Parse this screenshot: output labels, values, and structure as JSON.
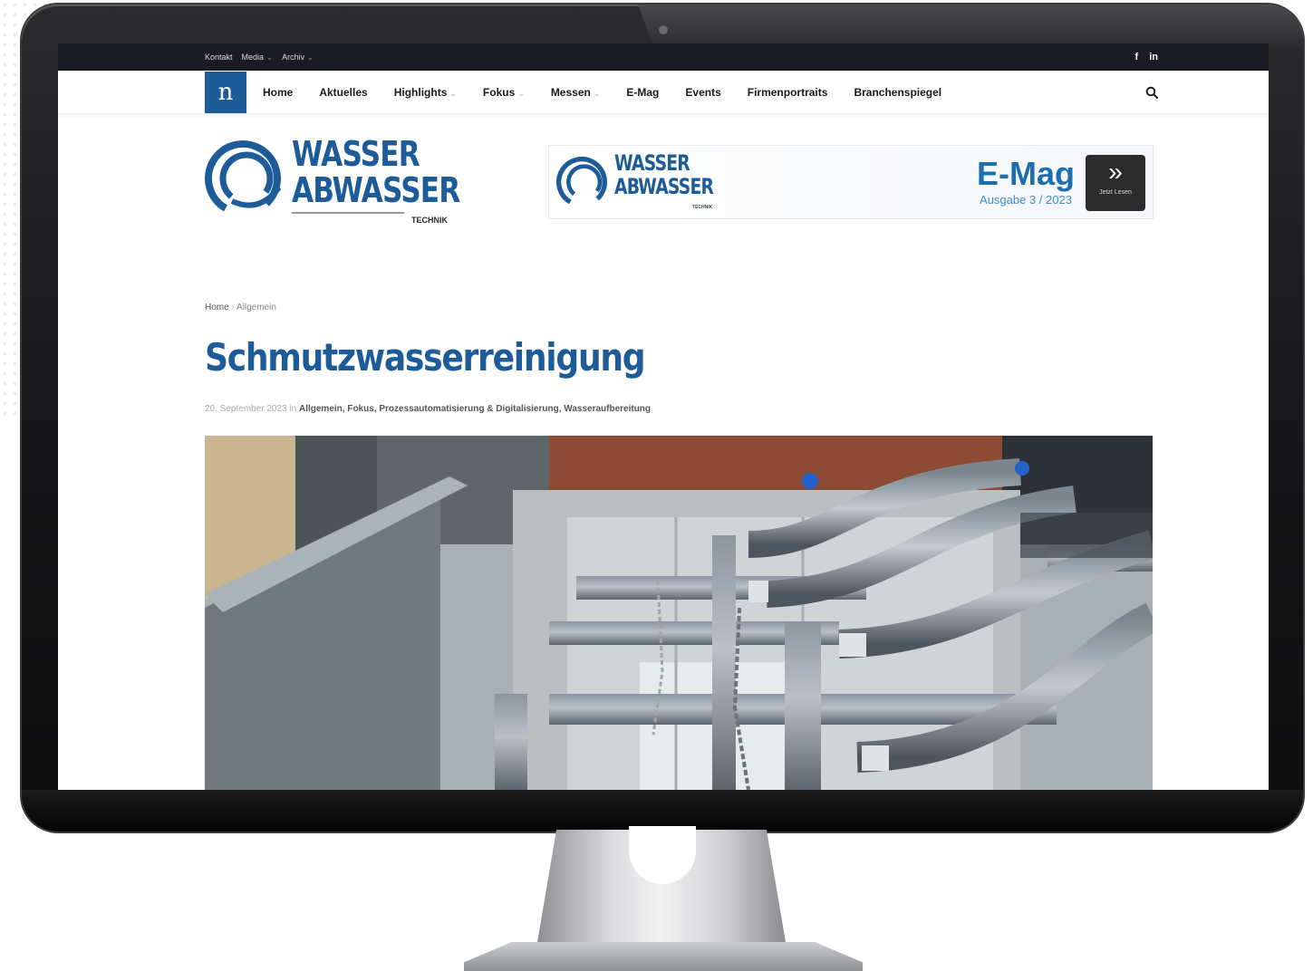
{
  "topbar": {
    "links": [
      "Kontakt",
      "Media",
      "Archiv"
    ],
    "social": [
      "f",
      "in"
    ]
  },
  "nav": {
    "logo_letter": "n",
    "items": [
      {
        "label": "Home",
        "caret": false
      },
      {
        "label": "Aktuelles",
        "caret": false
      },
      {
        "label": "Highlights",
        "caret": true
      },
      {
        "label": "Fokus",
        "caret": true
      },
      {
        "label": "Messen",
        "caret": true
      },
      {
        "label": "E-Mag",
        "caret": false
      },
      {
        "label": "Events",
        "caret": false
      },
      {
        "label": "Firmenportraits",
        "caret": false
      },
      {
        "label": "Branchenspiegel",
        "caret": false
      }
    ]
  },
  "brand": {
    "line1": "WASSER",
    "line2": "ABWASSER",
    "line3": "TECHNIK"
  },
  "banner": {
    "line1": "WASSER",
    "line2": "ABWASSER",
    "line3": "TECHNIK",
    "emag_title": "E-Mag",
    "emag_issue": "Ausgabe 3 / 2023",
    "button_label": "Jetzt Lesen"
  },
  "article": {
    "breadcrumb_home": "Home",
    "breadcrumb_current": "Allgemein",
    "title": "Schmutzwasserreinigung",
    "date": "20. September 2023",
    "in_label": "in",
    "categories": "Allgemein, Fokus, Prozessautomatisierung & Digitalisierung, Wasseraufbereitung"
  },
  "colors": {
    "brand_blue": "#1d5c98",
    "topbar_bg": "#1b1b24",
    "emag_blue": "#1d6fb0"
  }
}
